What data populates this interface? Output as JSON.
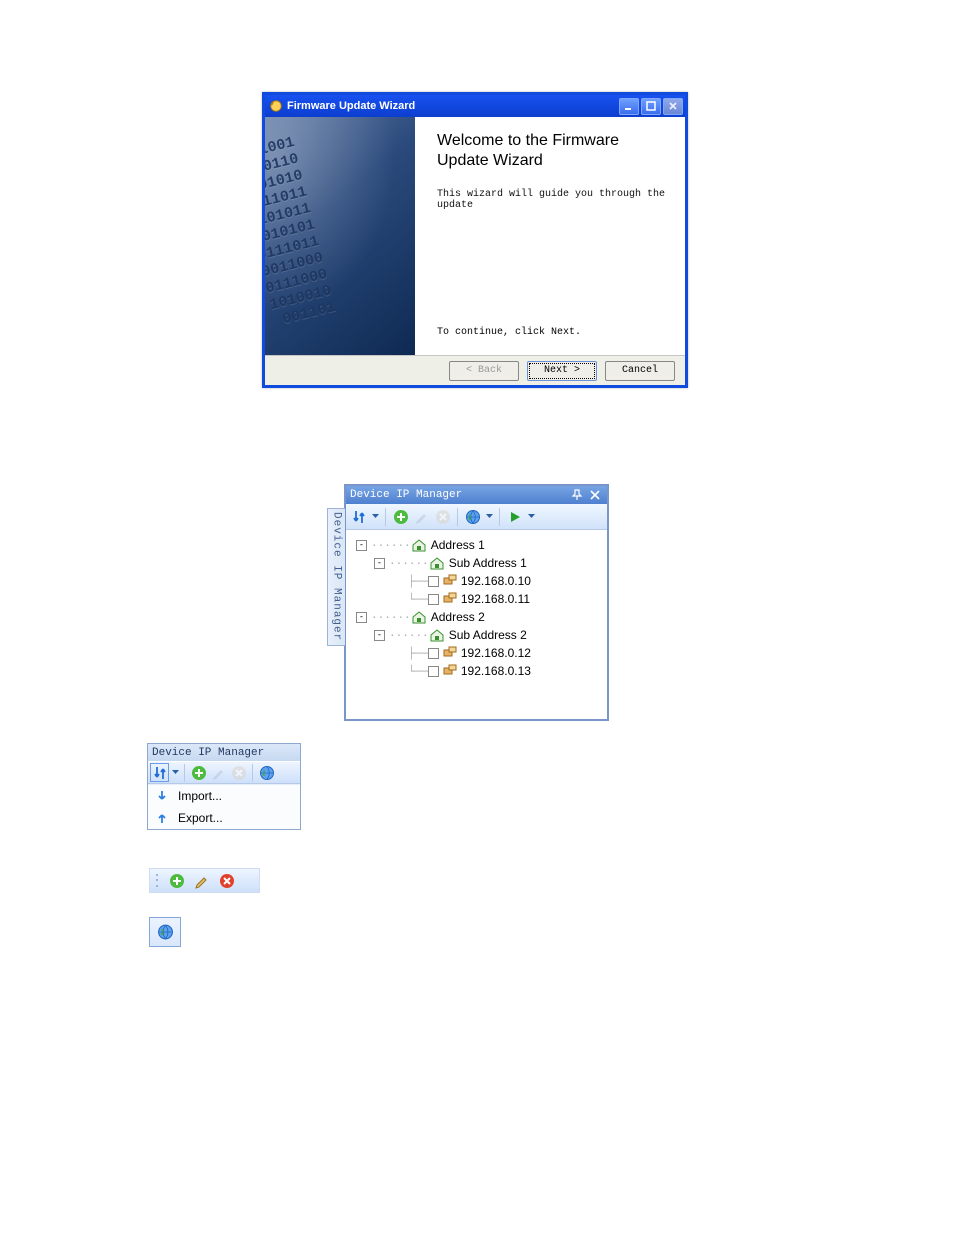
{
  "wizard": {
    "title": "Firmware Update Wizard",
    "heading_line1": "Welcome to the Firmware",
    "heading_line2": "Update Wizard",
    "description": "This wizard will guide you through the update",
    "continue_hint": "To continue, click Next.",
    "buttons": {
      "back": "< Back",
      "next": "Next >",
      "cancel": "Cancel"
    }
  },
  "dipm": {
    "title": "Device IP Manager",
    "dock_label": "Device IP Manager",
    "tree": {
      "addr1": "Address 1",
      "sub1": "Sub Address 1",
      "ip1": "192.168.0.10",
      "ip2": "192.168.0.11",
      "addr2": "Address 2",
      "sub2": "Sub Address 2",
      "ip3": "192.168.0.12",
      "ip4": "192.168.0.13"
    }
  },
  "mini": {
    "title": "Device IP Manager",
    "menu": {
      "import": "Import...",
      "export": "Export..."
    }
  },
  "icons": {
    "updown": "up-down-arrows-icon",
    "add": "add-icon",
    "edit": "edit-icon",
    "delete": "delete-icon",
    "globe": "globe-icon",
    "play": "play-icon",
    "pin": "pin-icon",
    "close": "close-icon",
    "house": "house-icon",
    "import_arrow": "import-arrow-icon",
    "export_arrow": "export-arrow-icon",
    "minimize": "minimize-icon",
    "maximize": "maximize-icon",
    "windowclose": "window-close-icon",
    "firmware": "firmware-icon"
  }
}
